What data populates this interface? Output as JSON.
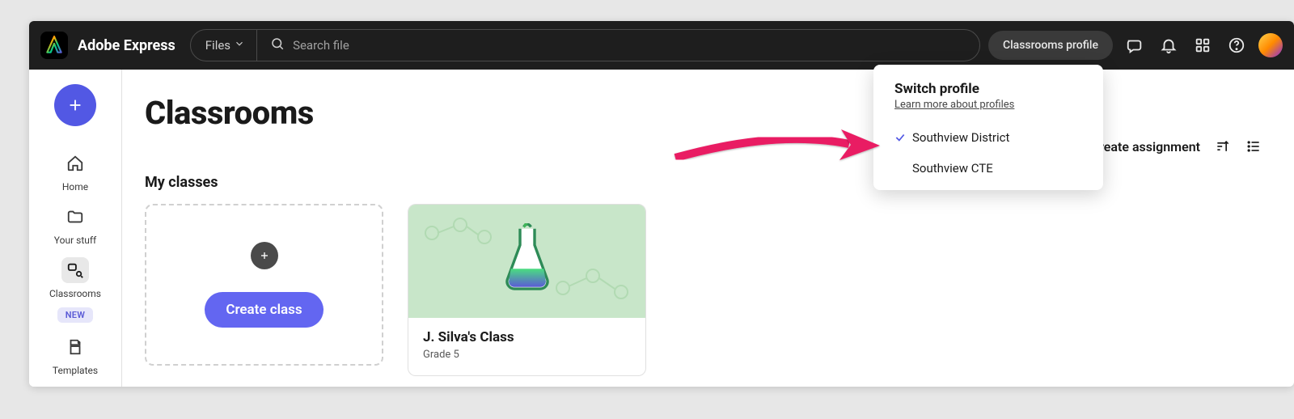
{
  "header": {
    "app_name": "Adobe Express",
    "files_dd_label": "Files",
    "search_placeholder": "Search file",
    "profile_btn_label": "Classrooms profile"
  },
  "sidebar": {
    "items": [
      {
        "key": "home",
        "label": "Home"
      },
      {
        "key": "your-stuff",
        "label": "Your stuff"
      },
      {
        "key": "classrooms",
        "label": "Classrooms",
        "badge": "NEW",
        "selected": true
      },
      {
        "key": "templates",
        "label": "Templates"
      }
    ]
  },
  "main": {
    "page_title": "Classrooms",
    "create_assignment_label": "Create assignment",
    "section_title": "My classes",
    "create_class_label": "Create class",
    "classes": [
      {
        "name": "J. Silva's Class",
        "subtitle": "Grade 5"
      }
    ]
  },
  "popover": {
    "title": "Switch profile",
    "learn_more": "Learn more about profiles",
    "items": [
      {
        "label": "Southview District",
        "checked": true
      },
      {
        "label": "Southview CTE",
        "checked": false
      }
    ]
  }
}
